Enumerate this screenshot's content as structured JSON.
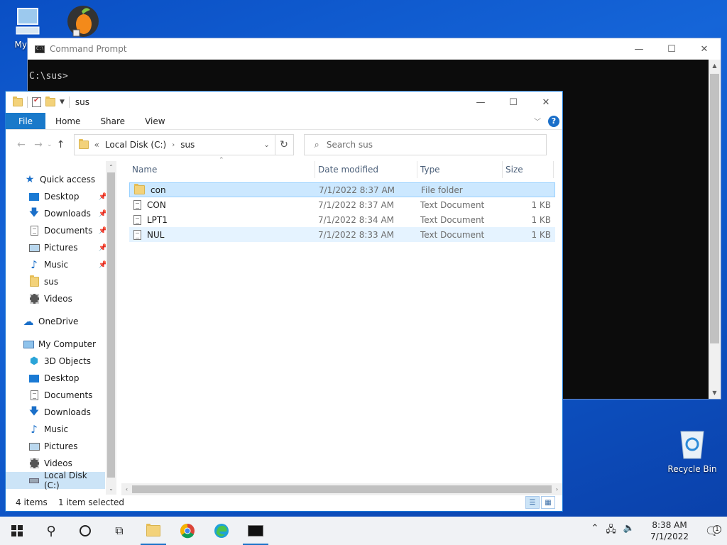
{
  "desktop": {
    "icons": [
      {
        "label": "My Co",
        "icon": "my-computer-icon"
      },
      {
        "label": "",
        "icon": "fl-studio-icon"
      }
    ],
    "recycle_bin": {
      "label": "Recycle Bin"
    }
  },
  "cmd": {
    "title": "Command Prompt",
    "prompt": "C:\\sus>"
  },
  "explorer": {
    "title": "sus",
    "ribbon": {
      "file": "File",
      "home": "Home",
      "share": "Share",
      "view": "View"
    },
    "address": {
      "prefix": "«",
      "crumbs": [
        "Local Disk (C:)",
        "sus"
      ]
    },
    "search": {
      "placeholder": "Search sus"
    },
    "nav": {
      "quick_access": "Quick access",
      "quick_items": [
        {
          "label": "Desktop",
          "pinned": true
        },
        {
          "label": "Downloads",
          "pinned": true
        },
        {
          "label": "Documents",
          "pinned": true
        },
        {
          "label": "Pictures",
          "pinned": true
        },
        {
          "label": "Music",
          "pinned": true
        },
        {
          "label": "sus",
          "pinned": false
        },
        {
          "label": "Videos",
          "pinned": false
        }
      ],
      "onedrive": "OneDrive",
      "my_computer": "My Computer",
      "computer_items": [
        {
          "label": "3D Objects"
        },
        {
          "label": "Desktop"
        },
        {
          "label": "Documents"
        },
        {
          "label": "Downloads"
        },
        {
          "label": "Music"
        },
        {
          "label": "Pictures"
        },
        {
          "label": "Videos"
        },
        {
          "label": "Local Disk (C:)"
        }
      ]
    },
    "columns": {
      "name": "Name",
      "date": "Date modified",
      "type": "Type",
      "size": "Size"
    },
    "files": [
      {
        "name": "con",
        "date": "7/1/2022 8:37 AM",
        "type": "File folder",
        "size": ""
      },
      {
        "name": "CON",
        "date": "7/1/2022 8:37 AM",
        "type": "Text Document",
        "size": "1 KB"
      },
      {
        "name": "LPT1",
        "date": "7/1/2022 8:34 AM",
        "type": "Text Document",
        "size": "1 KB"
      },
      {
        "name": "NUL",
        "date": "7/1/2022 8:33 AM",
        "type": "Text Document",
        "size": "1 KB"
      }
    ],
    "status": {
      "count": "4 items",
      "selected": "1 item selected"
    }
  },
  "taskbar": {
    "time": "8:38 AM",
    "date": "7/1/2022",
    "notification_count": "1"
  },
  "colors": {
    "accent": "#1979ca",
    "selection": "#cce8ff",
    "desktop": "#0e57c9"
  }
}
